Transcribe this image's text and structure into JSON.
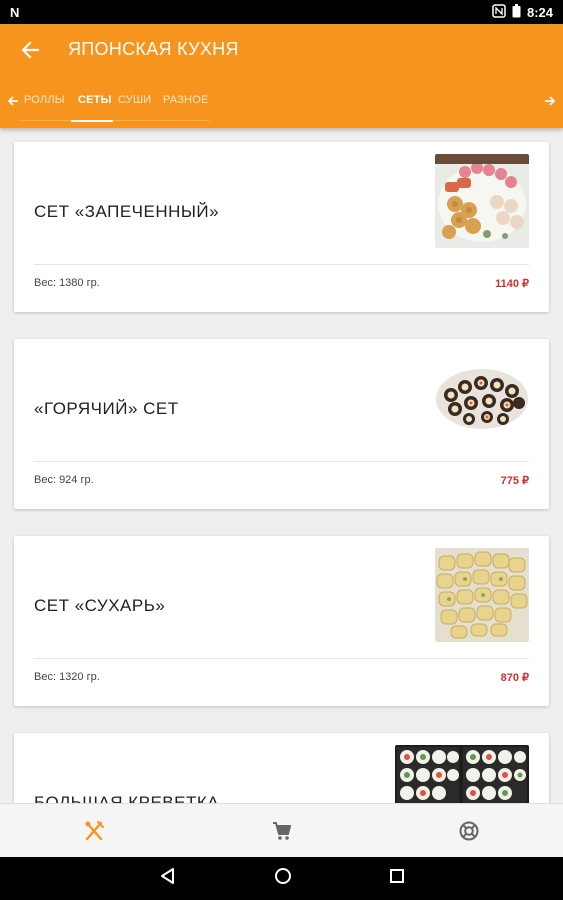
{
  "status_bar": {
    "time": "8:24",
    "n_label": "N"
  },
  "appbar": {
    "title": "ЯПОНСКАЯ КУХНЯ",
    "color": "#f7941d"
  },
  "tabs": [
    {
      "label": "РОЛЛЫ",
      "active": false
    },
    {
      "label": "СЕТЫ",
      "active": true
    },
    {
      "label": "СУШИ",
      "active": false
    },
    {
      "label": "РАЗНОЕ",
      "active": false
    }
  ],
  "items": [
    {
      "name": "СЕТ «ЗАПЕЧЕННЫЙ»",
      "weight": "Вес: 1380 гр.",
      "price": "1140 ₽"
    },
    {
      "name": "«ГОРЯЧИЙ» СЕТ",
      "weight": "Вес: 924 гр.",
      "price": "775 ₽"
    },
    {
      "name": "СЕТ «СУХАРЬ»",
      "weight": "Вес: 1320 гр.",
      "price": "870 ₽"
    },
    {
      "name": "БОЛЬШАЯ КРЕВЕТКА",
      "weight": "",
      "price": ""
    }
  ],
  "bottom_nav": [
    {
      "icon": "cutlery-icon",
      "active": true
    },
    {
      "icon": "cart-icon",
      "active": false
    },
    {
      "icon": "lifebuoy-icon",
      "active": false
    }
  ],
  "colors": {
    "accent": "#f7941d",
    "price": "#d32f2f"
  }
}
